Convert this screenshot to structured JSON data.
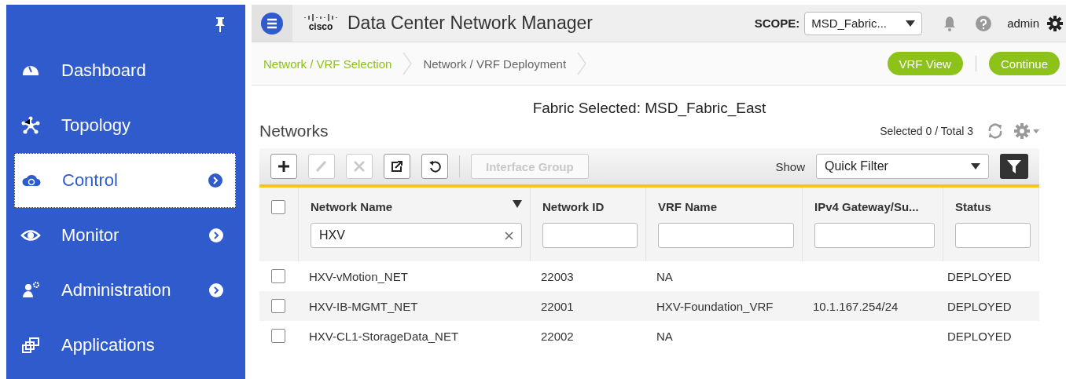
{
  "sidebar": {
    "items": [
      {
        "label": "Dashboard",
        "selected": false,
        "expandable": false
      },
      {
        "label": "Topology",
        "selected": false,
        "expandable": false
      },
      {
        "label": "Control",
        "selected": true,
        "expandable": true
      },
      {
        "label": "Monitor",
        "selected": false,
        "expandable": true
      },
      {
        "label": "Administration",
        "selected": false,
        "expandable": true
      },
      {
        "label": "Applications",
        "selected": false,
        "expandable": false
      }
    ]
  },
  "header": {
    "logo": "cisco",
    "title": "Data Center Network Manager",
    "scope_label": "SCOPE:",
    "scope_value": "MSD_Fabric...",
    "user": "admin"
  },
  "steps": [
    {
      "label": "Network / VRF Selection",
      "selected": true
    },
    {
      "label": "Network / VRF Deployment",
      "selected": false
    }
  ],
  "actions": [
    "VRF View",
    "Continue"
  ],
  "fabric_selected": "Fabric Selected: MSD_Fabric_East",
  "networks": {
    "title": "Networks",
    "summary": "Selected 0 / Total 3",
    "toolbar": [
      {
        "disabled": false
      },
      {
        "disabled": true
      },
      {
        "disabled": true
      },
      {
        "disabled": false
      },
      {
        "disabled": false
      }
    ],
    "interface_group": {
      "label": "Interface Group",
      "disabled": true
    },
    "show_label": "Show",
    "filter_value": "Quick Filter",
    "table": {
      "select_all": false,
      "columns": [
        {
          "label": "Network Name",
          "filter": "HXV",
          "sorted": true
        },
        {
          "label": "Network ID",
          "sorted": false
        },
        {
          "label": "VRF Name",
          "sorted": false
        },
        {
          "label": "IPv4 Gateway/Su...",
          "sorted": false
        },
        {
          "label": "Status",
          "sorted": false
        }
      ],
      "rows": [
        {
          "checked": false,
          "cells": [
            "HXV-vMotion_NET",
            "22003",
            "NA",
            "",
            "DEPLOYED"
          ]
        },
        {
          "checked": false,
          "cells": [
            "HXV-IB-MGMT_NET",
            "22001",
            "HXV-Foundation_VRF",
            "10.1.167.254/24",
            "DEPLOYED"
          ]
        },
        {
          "checked": false,
          "cells": [
            "HXV-CL1-StorageData_NET",
            "22002",
            "NA",
            "",
            "DEPLOYED"
          ]
        }
      ]
    }
  }
}
